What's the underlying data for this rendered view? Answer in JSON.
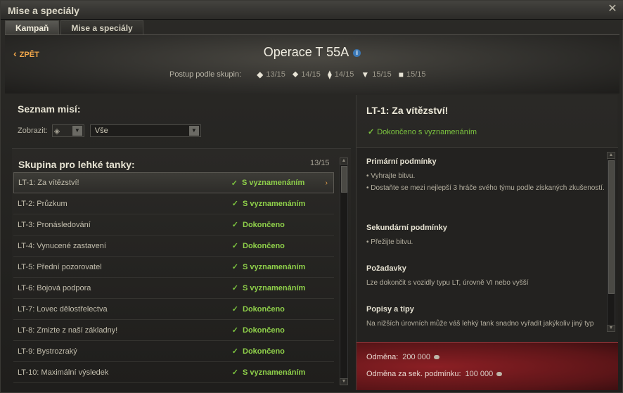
{
  "window": {
    "title": "Mise a speciály"
  },
  "tabs": [
    {
      "label": "Kampaň",
      "active": true
    },
    {
      "label": "Mise a speciály",
      "active": false
    }
  ],
  "header": {
    "back_label": "ZPĚT",
    "operation_title": "Operace T 55A",
    "progress_label": "Postup podle skupin:",
    "groups": [
      {
        "icon": "lt-icon",
        "value": "13/15"
      },
      {
        "icon": "mt-icon",
        "value": "14/15"
      },
      {
        "icon": "ht-icon",
        "value": "14/15"
      },
      {
        "icon": "td-icon",
        "value": "15/15"
      },
      {
        "icon": "spg-icon",
        "value": "15/15"
      }
    ]
  },
  "missions": {
    "title": "Seznam misí:",
    "filter_label": "Zobrazit:",
    "filter_value": "Vše",
    "group_title": "Skupina pro lehké tanky:",
    "group_count": "13/15",
    "items": [
      {
        "name": "LT-1: Za vítězství!",
        "status": "S vyznamenáním",
        "selected": true
      },
      {
        "name": "LT-2: Průzkum",
        "status": "S vyznamenáním"
      },
      {
        "name": "LT-3: Pronásledování",
        "status": "Dokončeno"
      },
      {
        "name": "LT-4: Vynucené zastavení",
        "status": "Dokončeno"
      },
      {
        "name": "LT-5: Přední pozorovatel",
        "status": "S vyznamenáním"
      },
      {
        "name": "LT-6: Bojová podpora",
        "status": "S vyznamenáním"
      },
      {
        "name": "LT-7: Lovec dělostřelectva",
        "status": "Dokončeno"
      },
      {
        "name": "LT-8: Zmizte z naší základny!",
        "status": "Dokončeno"
      },
      {
        "name": "LT-9: Bystrozraký",
        "status": "Dokončeno"
      },
      {
        "name": "LT-10: Maximální výsledek",
        "status": "S vyznamenáním"
      }
    ]
  },
  "detail": {
    "title": "LT-1: Za vítězství!",
    "status": "Dokončeno s vyznamenáním",
    "primary_title": "Primární podmínky",
    "primary_1": "• Vyhrajte bitvu.",
    "primary_2": "• Dostaňte se mezi nejlepší 3 hráče svého týmu podle získaných zkušeností.",
    "secondary_title": "Sekundární podmínky",
    "secondary_1": "• Přežijte bitvu.",
    "requirements_title": "Požadavky",
    "requirements_text": "Lze dokončit s vozidly typu LT, úrovně VI nebo vyšší",
    "tips_title": "Popisy a tipy",
    "tips_text": "Na nižších úrovních může váš lehký tank snadno vyřadit jakýkoliv jiný typ",
    "reward_label": "Odměna:",
    "reward_value": "200 000",
    "secondary_reward_label": "Odměna za sek. podmínku:",
    "secondary_reward_value": "100 000"
  },
  "colors": {
    "success": "#8fd04a",
    "accent": "#f0a64a",
    "reward_bg": "#8b1f24"
  }
}
